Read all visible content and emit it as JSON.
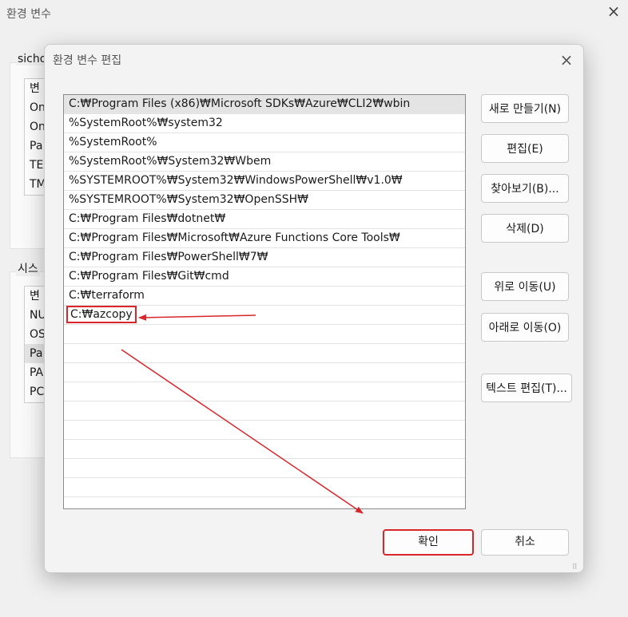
{
  "parent_window": {
    "title": "환경 변수",
    "close_icon": "close-icon",
    "user_group_label": "sicho",
    "system_group_label": "시스",
    "user_vars": [
      "변",
      "On",
      "On",
      "Pa",
      "TE",
      "TM"
    ],
    "system_vars": [
      "변",
      "NU",
      "OS",
      "Pa",
      "PA",
      "PC"
    ]
  },
  "dialog": {
    "title": "환경 변수 편집",
    "close_icon": "close-icon",
    "paths": [
      "C:₩Program Files (x86)₩Microsoft SDKs₩Azure₩CLI2₩wbin",
      "%SystemRoot%₩system32",
      "%SystemRoot%",
      "%SystemRoot%₩System32₩Wbem",
      "%SYSTEMROOT%₩System32₩WindowsPowerShell₩v1.0₩",
      "%SYSTEMROOT%₩System32₩OpenSSH₩",
      "C:₩Program Files₩dotnet₩",
      "C:₩Program Files₩Microsoft₩Azure Functions Core Tools₩",
      "C:₩Program Files₩PowerShell₩7₩",
      "C:₩Program Files₩Git₩cmd",
      "C:₩terraform",
      "C:₩azcopy"
    ],
    "buttons": {
      "new": "새로 만들기(N)",
      "edit": "편집(E)",
      "browse": "찾아보기(B)...",
      "delete": "삭제(D)",
      "move_up": "위로 이동(U)",
      "move_down": "아래로 이동(O)",
      "edit_text": "텍스트 편집(T)...",
      "ok": "확인",
      "cancel": "취소"
    },
    "resize_grip": "⠿"
  },
  "colors": {
    "annotation_red": "#d9262b",
    "selected_row": "#e4e4e4",
    "dialog_bg": "#f3f3f3"
  }
}
